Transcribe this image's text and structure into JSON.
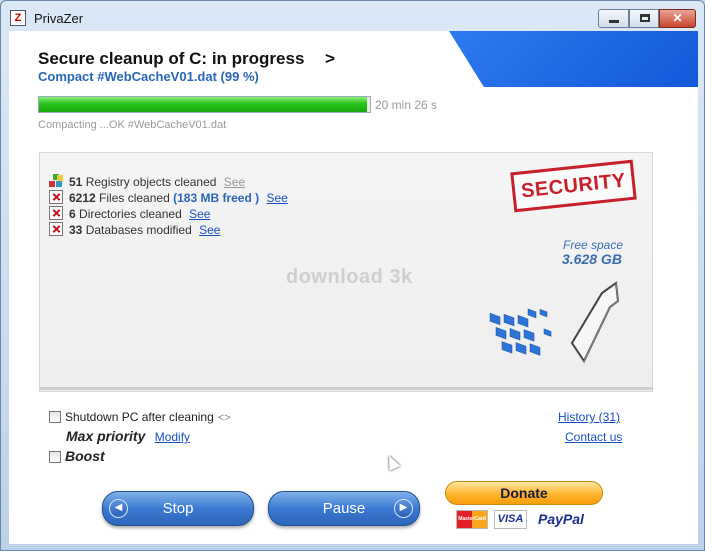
{
  "window": {
    "title": "PrivaZer",
    "app_icon": "privazer-logo-icon",
    "controls": [
      "minimize-icon",
      "maximize-icon",
      "close-icon"
    ]
  },
  "header": {
    "title": "Secure cleanup of C: in progress",
    "title_arrow": ">",
    "subtitle": "Compact #WebCacheV01.dat (99 %)"
  },
  "progress": {
    "percent": 99,
    "eta": "20 min 26 s",
    "status": "Compacting ...OK #WebCacheV01.dat"
  },
  "stats": [
    {
      "count": "51",
      "label": "Registry objects cleaned",
      "extra": "",
      "see": "See",
      "see_active": false,
      "icon": "registry-icon"
    },
    {
      "count": "6212",
      "label": "Files cleaned",
      "extra": "(183 MB freed )",
      "see": "See",
      "see_active": true,
      "icon": "red-x-icon"
    },
    {
      "count": "6",
      "label": "Directories cleaned",
      "extra": "",
      "see": "See",
      "see_active": true,
      "icon": "red-x-icon"
    },
    {
      "count": "33",
      "label": "Databases modified",
      "extra": "",
      "see": "See",
      "see_active": true,
      "icon": "red-x-icon"
    }
  ],
  "panel": {
    "watermark": "download 3k",
    "stamp": "SECURITY",
    "free_space_label": "Free space",
    "free_space_value": "3.628 GB"
  },
  "options": {
    "shutdown_label": "Shutdown PC after cleaning",
    "shutdown_checked": false,
    "priority_label": "Max priority",
    "modify_link": "Modify",
    "boost_label": "Boost",
    "boost_checked": false,
    "history_link": "History (31)",
    "contact_link": "Contact us"
  },
  "buttons": {
    "stop": "Stop",
    "pause": "Pause",
    "donate": "Donate"
  },
  "payment": {
    "mastercard": "MasterCard",
    "visa": "VISA",
    "paypal": "PayPal"
  },
  "colors": {
    "accent_blue": "#1257d8",
    "progress_green": "#27c21a",
    "stamp_red": "#c8202a",
    "link_blue": "#1a4fc4"
  }
}
